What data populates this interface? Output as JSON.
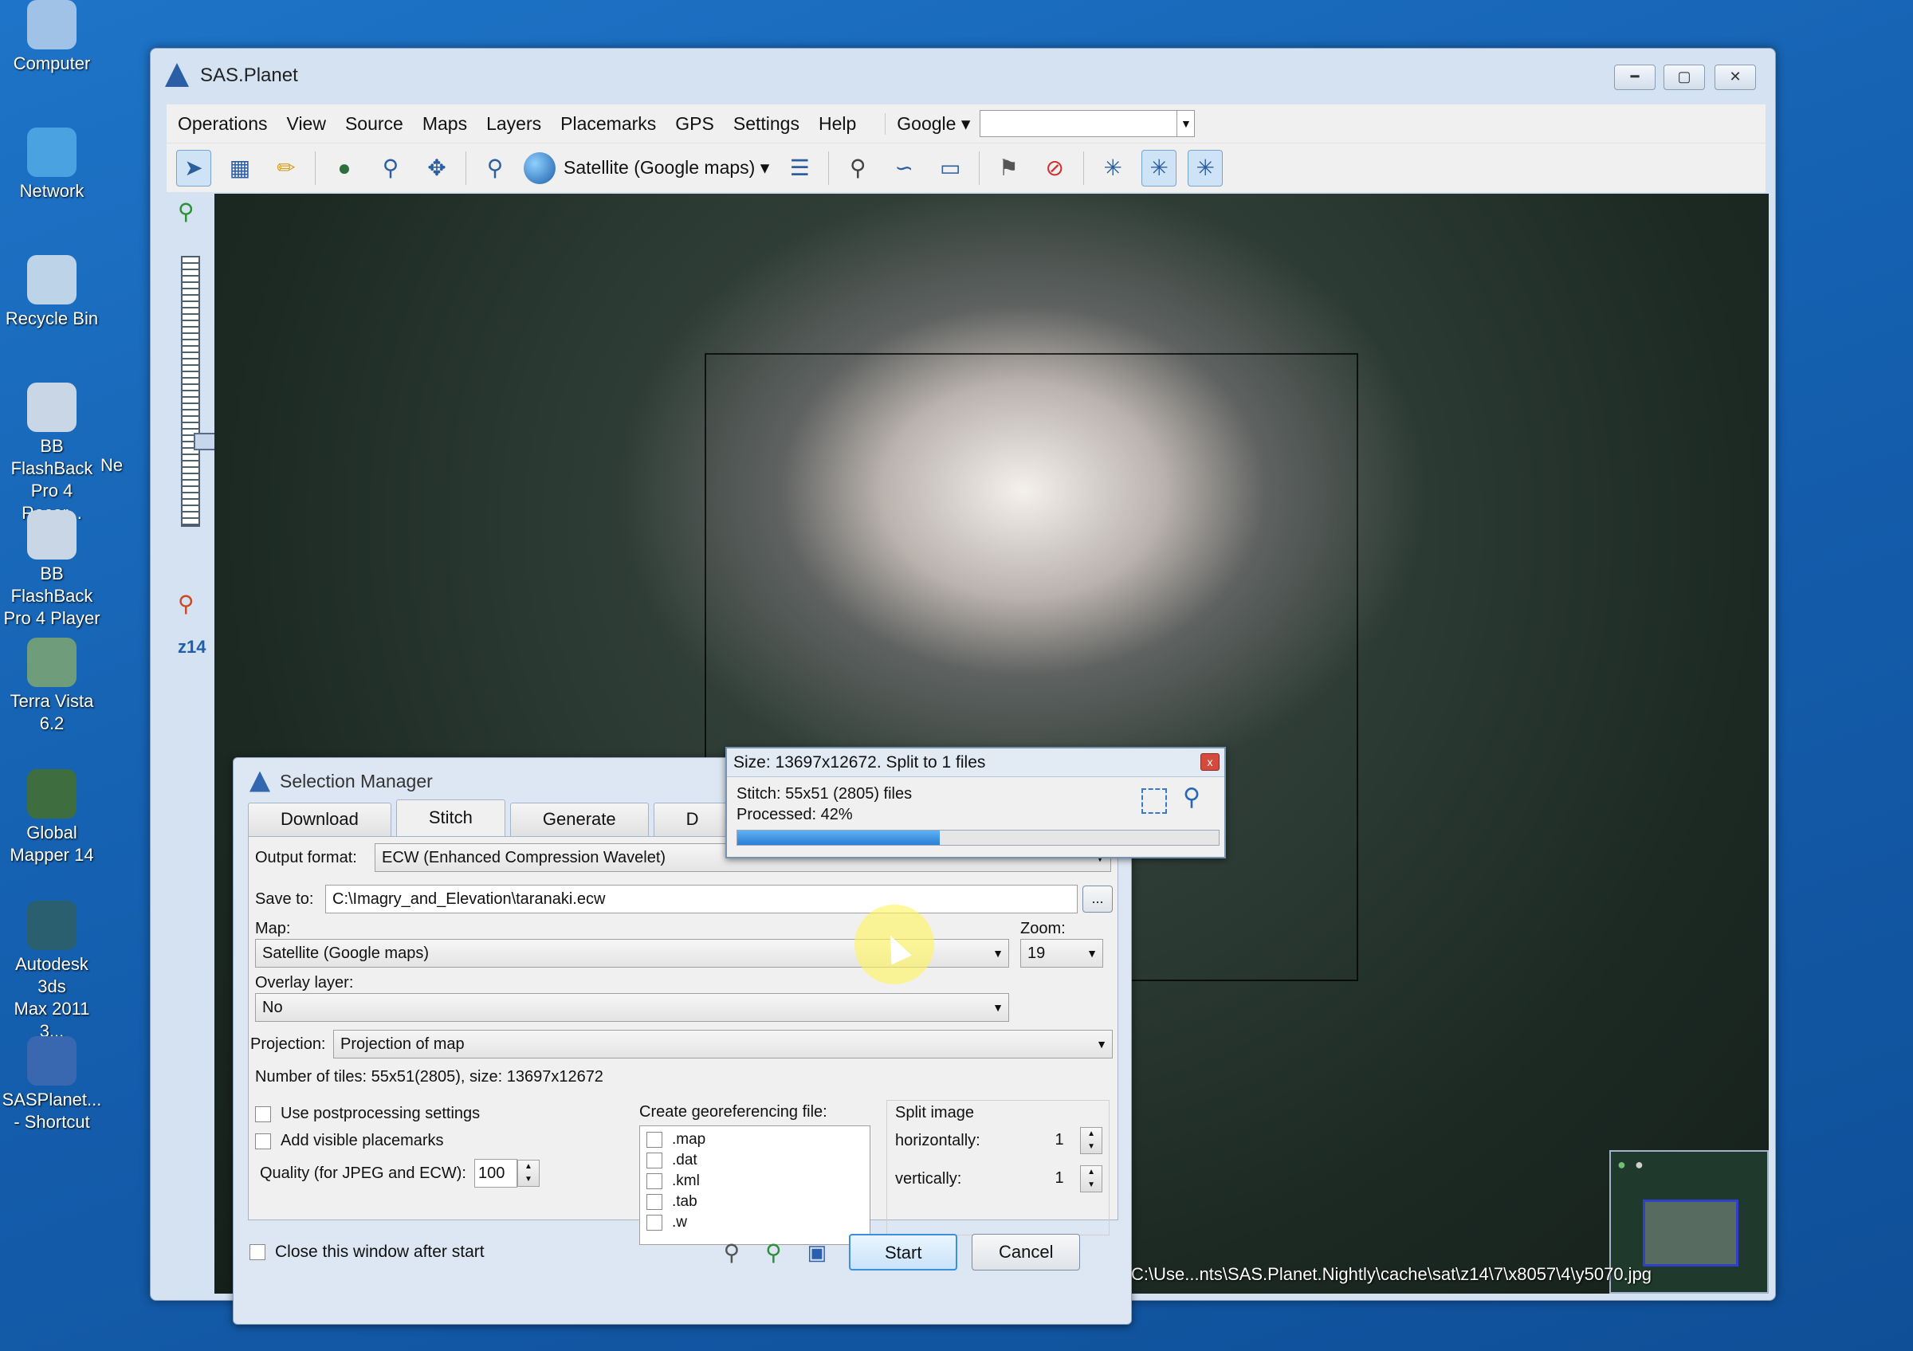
{
  "desktop": {
    "icons": [
      {
        "label": "Computer",
        "color": "#9fc2e6"
      },
      {
        "label": "Network",
        "color": "#4aa3e0"
      },
      {
        "label": "Recycle Bin",
        "color": "#bcd3e8"
      },
      {
        "label": "BB FlashBack\nPro 4 Recor...",
        "color": "#c9d6e6"
      },
      {
        "label": "BB FlashBack\nPro 4 Player",
        "color": "#c9d6e6"
      },
      {
        "label": "Terra Vista\n6.2",
        "color": "#6f9c7a"
      },
      {
        "label": "Global\nMapper 14",
        "color": "#3e6d3f"
      },
      {
        "label": "Autodesk 3ds\nMax 2011 3...",
        "color": "#2a5f70"
      },
      {
        "label": "SASPlanet...\n- Shortcut",
        "color": "#3a68b0"
      }
    ],
    "partial_label": "Ne"
  },
  "app": {
    "title": "SAS.Planet",
    "menu": [
      "Operations",
      "View",
      "Source",
      "Maps",
      "Layers",
      "Placemarks",
      "GPS",
      "Settings",
      "Help"
    ],
    "geocoder": "Google",
    "search_value": "",
    "map_type_label": "Satellite (Google maps)",
    "zoom_level": "z14",
    "status_path": "C:\\Use...nts\\SAS.Planet.Nightly\\cache\\sat\\z14\\7\\x8057\\4\\y5070.jpg"
  },
  "toolbar_icons": [
    "cursor-select-icon",
    "rect-select-icon",
    "ruler-icon",
    "globe-icon",
    "magnifier-icon",
    "fullscreen-icon",
    "satellite-dish-icon",
    "layers-icon",
    "placemark-icon",
    "path-icon",
    "polygon-icon",
    "marks-icon",
    "no-marks-icon",
    "gps-icon",
    "gps-track-icon",
    "gps-center-icon"
  ],
  "selection_manager": {
    "title": "Selection Manager",
    "tabs": [
      "Download",
      "Stitch",
      "Generate",
      "D"
    ],
    "output_format_label": "Output format:",
    "output_format_value": "ECW (Enhanced Compression Wavelet)",
    "save_to_label": "Save to:",
    "save_to_value": "C:\\Imagry_and_Elevation\\taranaki.ecw",
    "browse_label": "...",
    "map_label": "Map:",
    "map_value": "Satellite (Google maps)",
    "zoom_label": "Zoom:",
    "zoom_value": "19",
    "overlay_label": "Overlay layer:",
    "overlay_value": "No",
    "projection_label": "Projection:",
    "projection_value": "Projection of map",
    "tiles_info": "Number of tiles: 55x51(2805), size: 13697x12672",
    "use_postprocessing": "Use postprocessing settings",
    "add_placemarks": "Add visible placemarks",
    "quality_label": "Quality (for JPEG and ECW):",
    "quality_value": "100",
    "georef_label": "Create georeferencing file:",
    "georef_options": [
      ".map",
      ".dat",
      ".kml",
      ".tab",
      ".w"
    ],
    "split_label": "Split image",
    "horizontally_label": "horizontally:",
    "horizontally_value": "1",
    "vertically_label": "vertically:",
    "vertically_value": "1",
    "close_after_start": "Close this window after start",
    "start_label": "Start",
    "cancel_label": "Cancel"
  },
  "progress_dialog": {
    "title": "Size: 13697x12672. Split to 1 files",
    "stitch_text": "Stitch: 55x51 (2805) files",
    "processed_text": "Processed: 42%",
    "progress_fraction": 0.42,
    "close_glyph": "x"
  }
}
